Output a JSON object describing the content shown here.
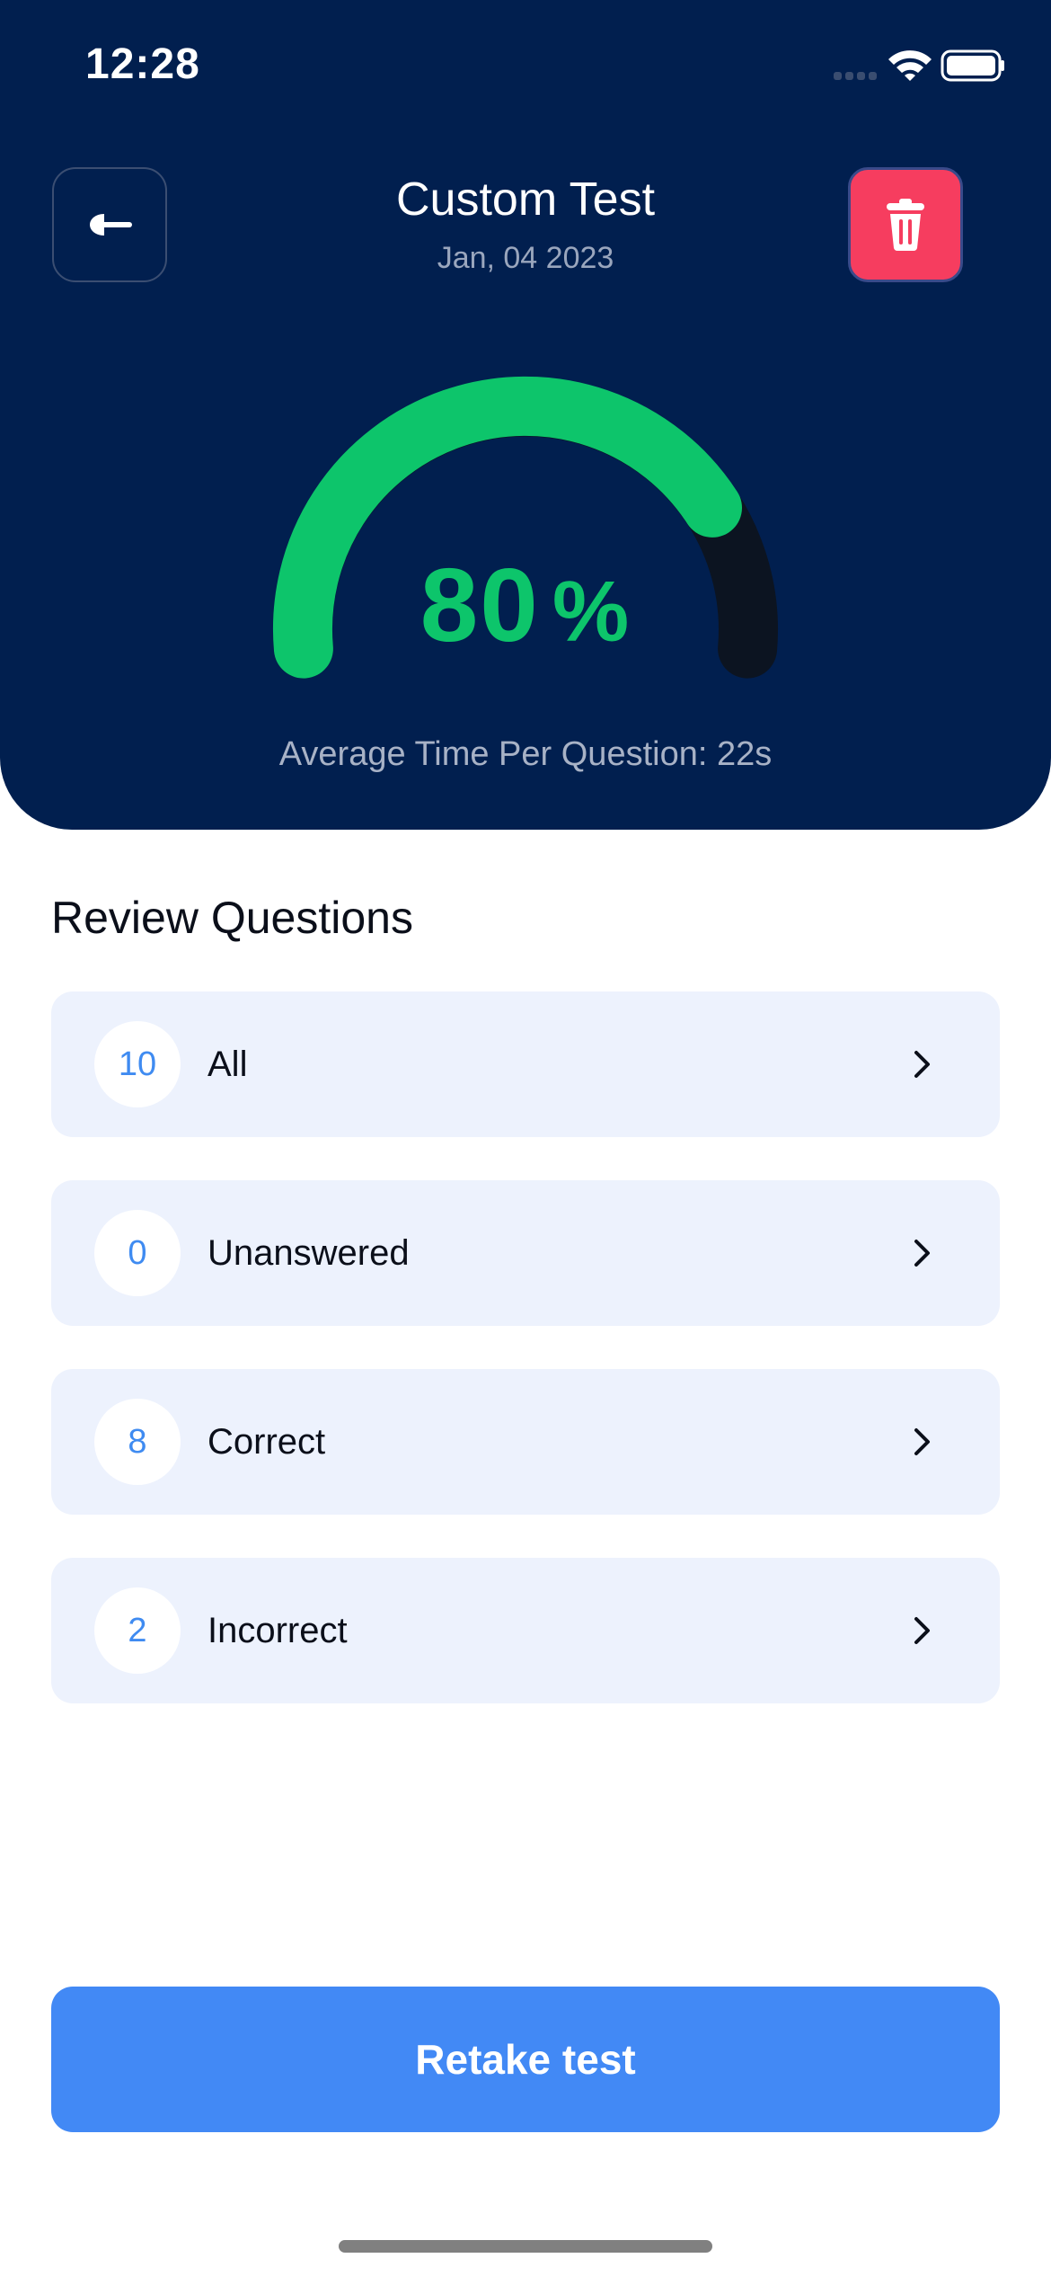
{
  "status_bar": {
    "time": "12:28"
  },
  "header": {
    "title": "Custom Test",
    "date": "Jan, 04 2023",
    "back_icon": "back-arrow-icon",
    "delete_icon": "trash-icon"
  },
  "score": {
    "value": "80",
    "unit": "%",
    "progress_fraction": 0.8,
    "average_time": "Average Time Per Question: 22s"
  },
  "review": {
    "title": "Review Questions",
    "items": [
      {
        "count": "10",
        "label": "All"
      },
      {
        "count": "0",
        "label": "Unanswered"
      },
      {
        "count": "8",
        "label": "Correct"
      },
      {
        "count": "2",
        "label": "Incorrect"
      }
    ]
  },
  "retake_label": "Retake test",
  "colors": {
    "header_bg": "#011f4f",
    "gauge_fill": "#0dc56b",
    "gauge_track": "#0c1421",
    "accent_blue": "#4289f5",
    "delete_red": "#f63d5f",
    "row_bg": "#edf2fd"
  }
}
